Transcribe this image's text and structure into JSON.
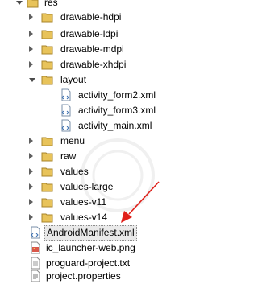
{
  "tree": {
    "res": "res",
    "drawable_hdpi": "drawable-hdpi",
    "drawable_ldpi": "drawable-ldpi",
    "drawable_mdpi": "drawable-mdpi",
    "drawable_xhdpi": "drawable-xhdpi",
    "layout": "layout",
    "activity_form2": "activity_form2.xml",
    "activity_form3": "activity_form3.xml",
    "activity_main": "activity_main.xml",
    "menu": "menu",
    "raw": "raw",
    "values": "values",
    "values_large": "values-large",
    "values_v11": "values-v11",
    "values_v14": "values-v14",
    "android_manifest": "AndroidManifest.xml",
    "ic_launcher_web": "ic_launcher-web.png",
    "proguard_project": "proguard-project.txt",
    "project_properties": "project.properties"
  },
  "colors": {
    "folder": "#e8c35a",
    "arrow": "#e0201a",
    "selection": "#e9e9e9"
  },
  "icons": [
    "folder-icon",
    "xml-file-icon",
    "image-file-icon",
    "text-file-icon",
    "properties-file-icon"
  ]
}
